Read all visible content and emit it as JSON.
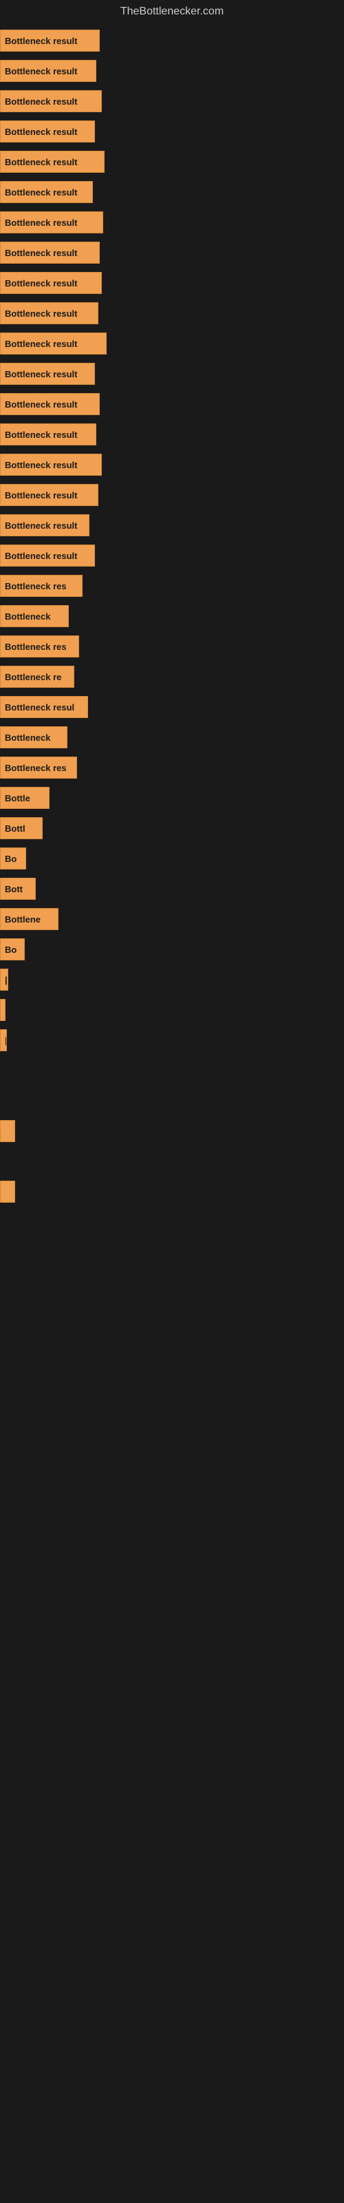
{
  "site_title": "TheBottlenecker.com",
  "bars": [
    {
      "label": "Bottleneck result",
      "width": 145
    },
    {
      "label": "Bottleneck result",
      "width": 140
    },
    {
      "label": "Bottleneck result",
      "width": 148
    },
    {
      "label": "Bottleneck result",
      "width": 138
    },
    {
      "label": "Bottleneck result",
      "width": 152
    },
    {
      "label": "Bottleneck result",
      "width": 135
    },
    {
      "label": "Bottleneck result",
      "width": 150
    },
    {
      "label": "Bottleneck result",
      "width": 145
    },
    {
      "label": "Bottleneck result",
      "width": 148
    },
    {
      "label": "Bottleneck result",
      "width": 143
    },
    {
      "label": "Bottleneck result",
      "width": 155
    },
    {
      "label": "Bottleneck result",
      "width": 138
    },
    {
      "label": "Bottleneck result",
      "width": 145
    },
    {
      "label": "Bottleneck result",
      "width": 140
    },
    {
      "label": "Bottleneck result",
      "width": 148
    },
    {
      "label": "Bottleneck result",
      "width": 143
    },
    {
      "label": "Bottleneck result",
      "width": 130
    },
    {
      "label": "Bottleneck result",
      "width": 138
    },
    {
      "label": "Bottleneck res",
      "width": 120
    },
    {
      "label": "Bottleneck",
      "width": 100
    },
    {
      "label": "Bottleneck res",
      "width": 115
    },
    {
      "label": "Bottleneck re",
      "width": 108
    },
    {
      "label": "Bottleneck resul",
      "width": 128
    },
    {
      "label": "Bottleneck",
      "width": 98
    },
    {
      "label": "Bottleneck res",
      "width": 112
    },
    {
      "label": "Bottle",
      "width": 72
    },
    {
      "label": "Bottl",
      "width": 62
    },
    {
      "label": "Bo",
      "width": 38
    },
    {
      "label": "Bott",
      "width": 52
    },
    {
      "label": "Bottlene",
      "width": 85
    },
    {
      "label": "Bo",
      "width": 36
    },
    {
      "label": "|",
      "width": 12
    },
    {
      "label": "",
      "width": 8
    },
    {
      "label": "|",
      "width": 10
    },
    {
      "label": "",
      "width": 0
    },
    {
      "label": "",
      "width": 0
    },
    {
      "label": "",
      "width": 22
    },
    {
      "label": "",
      "width": 0
    },
    {
      "label": "",
      "width": 22
    }
  ]
}
